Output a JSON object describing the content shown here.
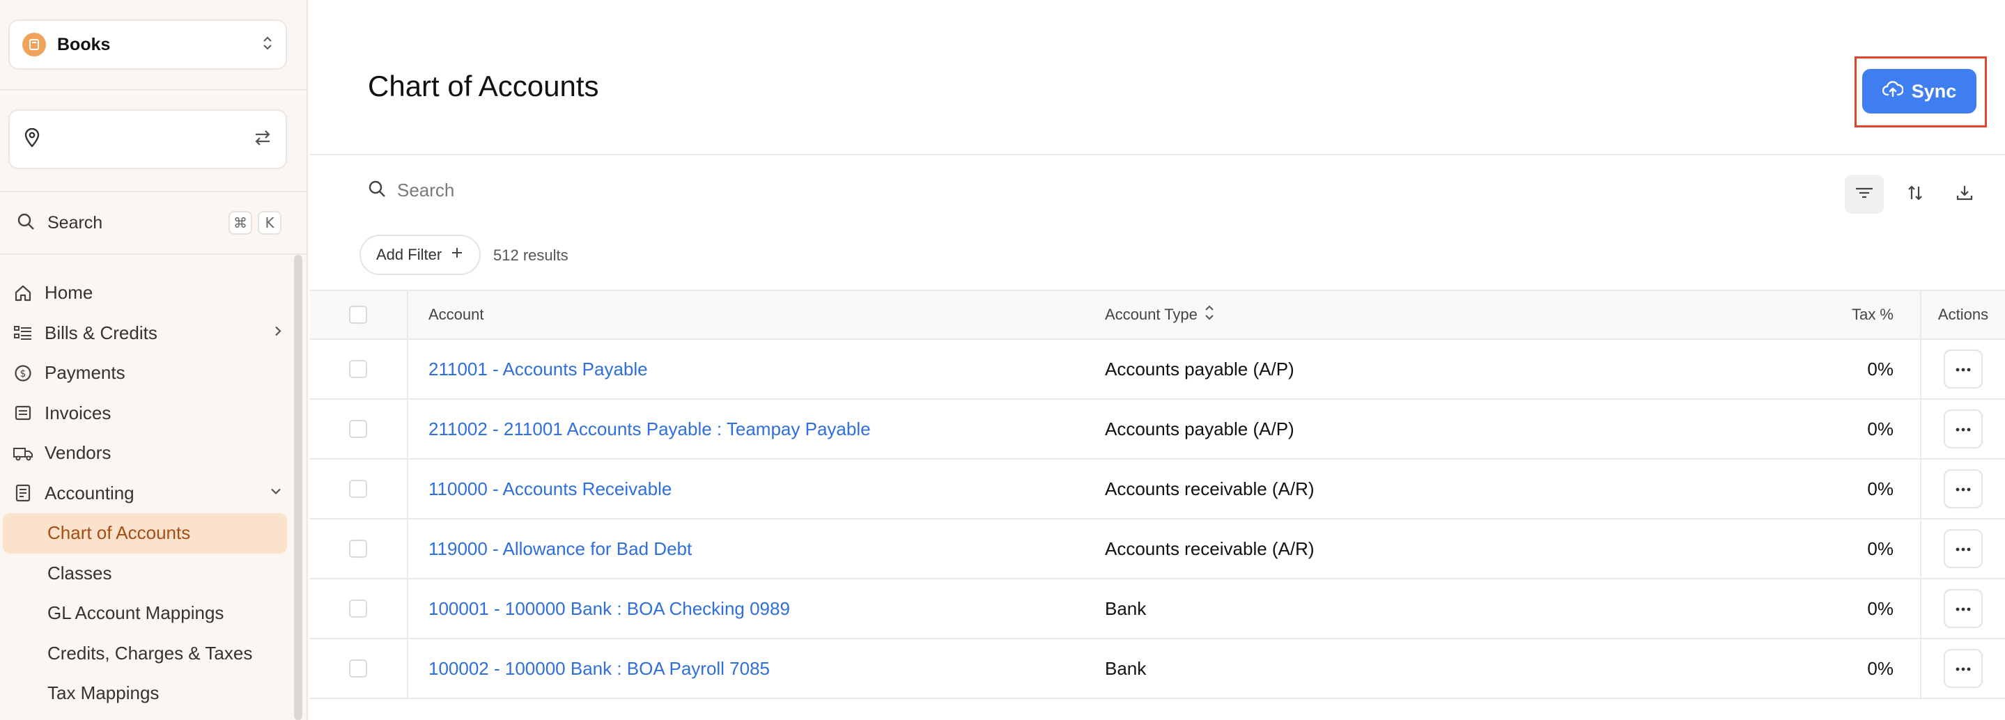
{
  "sidebar": {
    "workspace": {
      "name": "Books",
      "icon": "book-icon"
    },
    "location": {
      "icon": "map-pin-icon",
      "swap_icon": "swap-arrows-icon"
    },
    "search": {
      "label": "Search",
      "shortcut_mod": "⌘",
      "shortcut_key": "K"
    },
    "nav": [
      {
        "label": "Home",
        "icon": "home-icon"
      },
      {
        "label": "Bills & Credits",
        "icon": "bills-icon",
        "chevron": "chevron-right-icon"
      },
      {
        "label": "Payments",
        "icon": "dollar-circle-icon"
      },
      {
        "label": "Invoices",
        "icon": "invoice-icon"
      },
      {
        "label": "Vendors",
        "icon": "truck-icon"
      },
      {
        "label": "Accounting",
        "icon": "ledger-icon",
        "chevron": "chevron-down-icon"
      }
    ],
    "accounting_sub": [
      {
        "label": "Chart of Accounts",
        "active": true
      },
      {
        "label": "Classes"
      },
      {
        "label": "GL Account Mappings"
      },
      {
        "label": "Credits, Charges & Taxes"
      },
      {
        "label": "Tax Mappings"
      }
    ]
  },
  "main": {
    "title": "Chart of Accounts",
    "sync_label": "Sync",
    "search_placeholder": "Search",
    "add_filter_label": "Add Filter",
    "results_count": "512 results",
    "columns": {
      "account": "Account",
      "account_type": "Account Type",
      "tax": "Tax %",
      "actions": "Actions"
    },
    "rows": [
      {
        "account": "211001 - Accounts Payable",
        "type": "Accounts payable (A/P)",
        "tax": "0%"
      },
      {
        "account": "211002 - 211001 Accounts Payable : Teampay Payable",
        "type": "Accounts payable (A/P)",
        "tax": "0%"
      },
      {
        "account": "110000 - Accounts Receivable",
        "type": "Accounts receivable (A/R)",
        "tax": "0%"
      },
      {
        "account": "119000 - Allowance for Bad Debt",
        "type": "Accounts receivable (A/R)",
        "tax": "0%"
      },
      {
        "account": "100001 - 100000 Bank : BOA Checking 0989",
        "type": "Bank",
        "tax": "0%"
      },
      {
        "account": "100002 - 100000 Bank : BOA Payroll 7085",
        "type": "Bank",
        "tax": "0%"
      }
    ]
  },
  "colors": {
    "accent": "#3f7ef1",
    "link": "#2f6fdc",
    "sidebar_bg": "#fbf6f1",
    "active_nav_bg": "#fbe2cc",
    "active_nav_text": "#a54d12",
    "highlight_border": "#e0462f"
  }
}
